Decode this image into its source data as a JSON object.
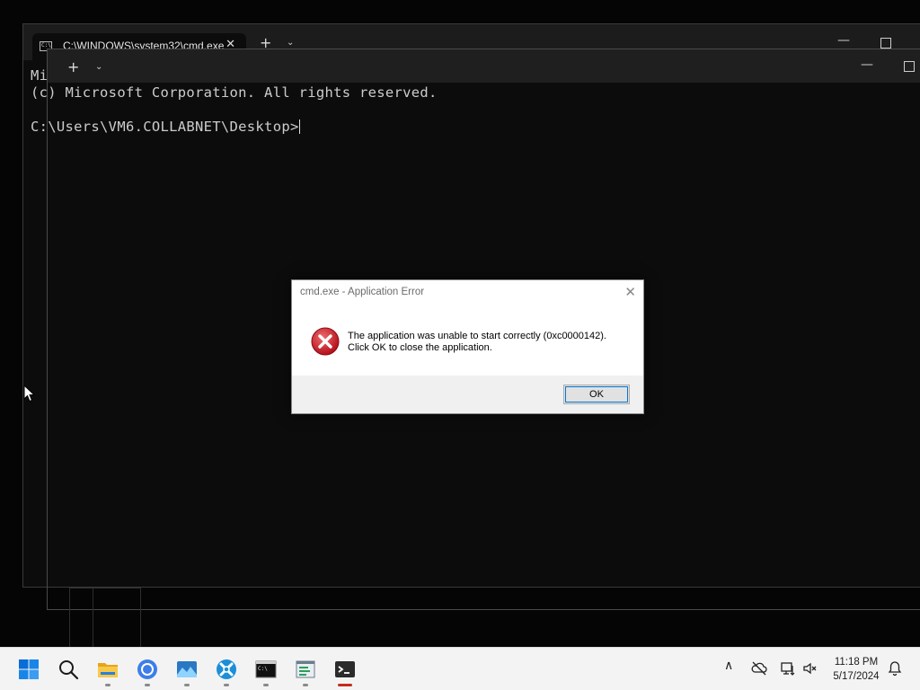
{
  "background_window": {
    "tab_title": "C:\\WINDOWS\\system32\\cmd.exe",
    "cmd_icon_text": "C:\\",
    "new_tab_glyph": "+",
    "dropdown_glyph": "⌄",
    "minimize_glyph": "—",
    "close_tab_glyph": "✕"
  },
  "foreground_window": {
    "new_tab_glyph": "+",
    "dropdown_glyph": "⌄",
    "minimize_glyph": "—"
  },
  "terminal": {
    "line1": "Mi",
    "line2": "(c) Microsoft Corporation. All rights reserved.",
    "prompt": "C:\\Users\\VM6.COLLABNET\\Desktop>"
  },
  "dialog": {
    "title": "cmd.exe - Application Error",
    "close_glyph": "✕",
    "message_line1": "The application was unable to start correctly (0xc0000142).",
    "message_line2": "Click OK to close the application.",
    "ok_label": "OK",
    "icon": "error-icon",
    "icon_color": "#d11f2a"
  },
  "taskbar": {
    "apps": [
      {
        "name": "start-icon"
      },
      {
        "name": "search-icon"
      },
      {
        "name": "file-explorer-icon"
      },
      {
        "name": "chrome-icon"
      },
      {
        "name": "photos-icon"
      },
      {
        "name": "settings-app-icon"
      },
      {
        "name": "cmd-app-icon"
      },
      {
        "name": "notepad-app-icon"
      },
      {
        "name": "terminal-app-icon"
      }
    ],
    "tray": {
      "chevron_glyph": "∧",
      "time": "11:18 PM",
      "date": "5/17/2024"
    },
    "accent_color": "#c42b1c"
  }
}
